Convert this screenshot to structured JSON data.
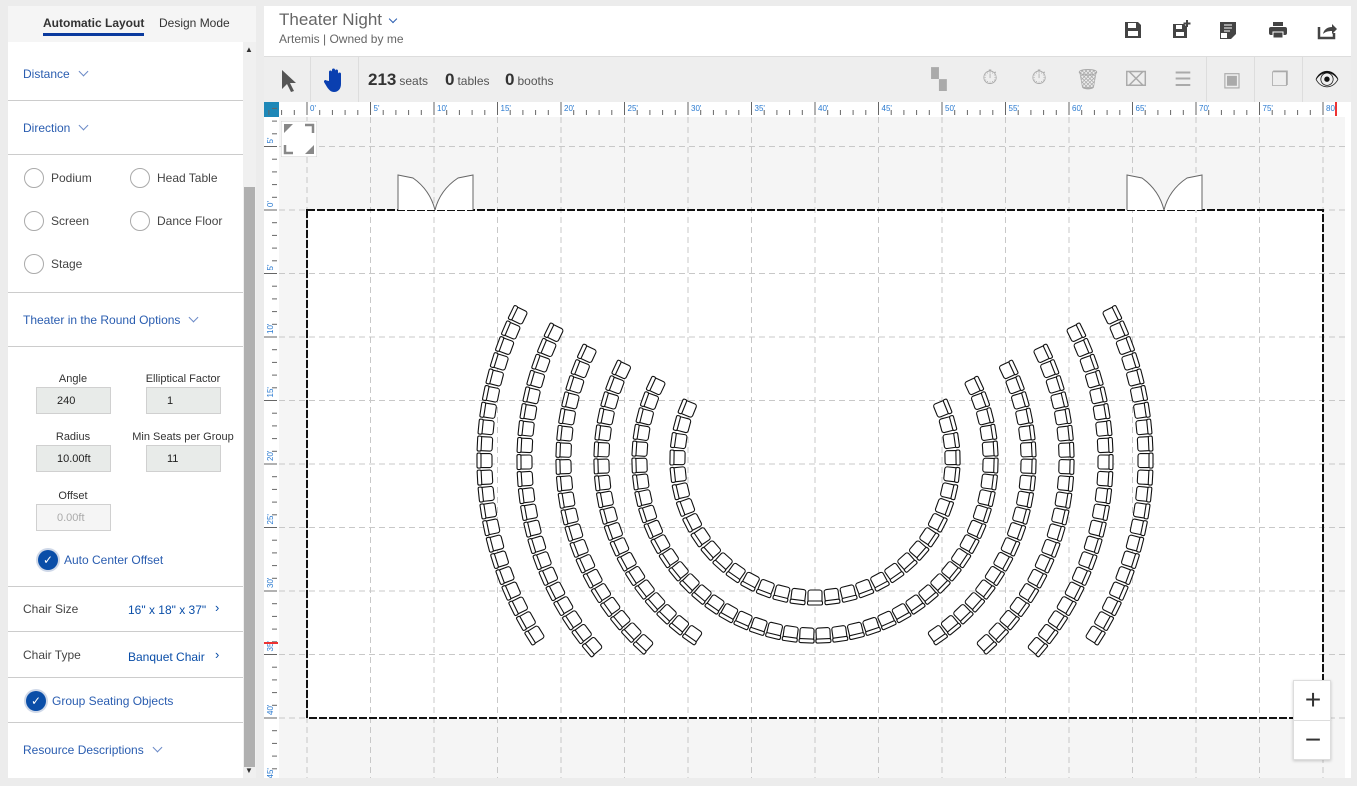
{
  "left_panel": {
    "tabs": [
      "Automatic Layout",
      "Design Mode"
    ],
    "sections": {
      "distance": "Distance",
      "direction": "Direction",
      "theater_round": "Theater in the Round Options",
      "resource": "Resource Descriptions"
    },
    "focal_points": [
      "Podium",
      "Head Table",
      "Screen",
      "Dance Floor",
      "Stage"
    ],
    "fields": {
      "angle": {
        "label": "Angle",
        "value": "240"
      },
      "elliptical": {
        "label": "Elliptical Factor",
        "value": "1"
      },
      "radius": {
        "label": "Radius",
        "value": "10.00ft"
      },
      "min_seats": {
        "label": "Min Seats per Group",
        "value": "11"
      },
      "offset": {
        "label": "Offset",
        "value": "0.00ft"
      }
    },
    "auto_center_offset": {
      "label": "Auto Center Offset",
      "checked": true
    },
    "chair_size": {
      "label": "Chair Size",
      "value": "16\" x 18\" x 37\""
    },
    "chair_type": {
      "label": "Chair Type",
      "value": "Banquet Chair"
    },
    "group_seating": {
      "label": "Group Seating Objects",
      "checked": true
    }
  },
  "header": {
    "title": "Theater Night",
    "subtitle": "Artemis |  Owned by me",
    "icons": [
      "save-icon",
      "save-as-icon",
      "notes-icon",
      "print-icon",
      "share-icon"
    ]
  },
  "toolbar": {
    "seats": "213",
    "seats_label": "seats",
    "tables": "0",
    "tables_label": "tables",
    "booths": "0",
    "booths_label": "booths"
  },
  "ruler": {
    "x_labels": [
      "0'",
      "5'",
      "10'",
      "15'",
      "20'",
      "25'",
      "30'",
      "35'",
      "40'",
      "45'",
      "50'",
      "55'",
      "60'",
      "65'",
      "70'",
      "75'",
      "80'"
    ],
    "y_labels": [
      "5'",
      "0'",
      "5'",
      "10'",
      "15'",
      "20'",
      "25'",
      "30'",
      "35'",
      "40'",
      "45'"
    ]
  },
  "zoom": {
    "in": "+",
    "out": "−"
  },
  "colors": {
    "accent": "#0a4ea8",
    "ruler_corner": "#1e88b8"
  }
}
